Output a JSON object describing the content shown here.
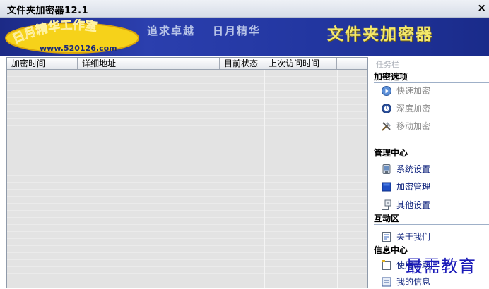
{
  "window": {
    "title": "文件夹加密器12.1",
    "close_glyph": "×"
  },
  "banner": {
    "logo_text": "日月精华工作室",
    "logo_url_text": "www.520126.com",
    "slogan_1": "追求卓越",
    "slogan_2": "日月精华",
    "app_name": "文件夹加密器"
  },
  "list": {
    "columns": [
      "加密时间",
      "详细地址",
      "目前状态",
      "上次访问时间"
    ]
  },
  "task_pane": {
    "title": "任务栏",
    "groups": [
      {
        "label": "加密选项",
        "items": [
          {
            "label": "快速加密",
            "icon": "quick-encrypt-icon"
          },
          {
            "label": "深度加密",
            "icon": "deep-encrypt-icon"
          },
          {
            "label": "移动加密",
            "icon": "move-encrypt-icon"
          }
        ]
      },
      {
        "label": "管理中心",
        "items": [
          {
            "label": "系统设置",
            "icon": "system-settings-icon"
          },
          {
            "label": "加密管理",
            "icon": "encrypt-manage-icon"
          },
          {
            "label": "其他设置",
            "icon": "other-settings-icon"
          }
        ]
      },
      {
        "label": "互动区",
        "items": [
          {
            "label": "关于我们",
            "icon": "about-icon"
          }
        ]
      },
      {
        "label": "信息中心",
        "items": [
          {
            "label": "使用帮助",
            "icon": "help-icon"
          },
          {
            "label": "我的信息",
            "icon": "my-info-icon"
          }
        ]
      }
    ]
  },
  "watermark": "最需教育",
  "colors": {
    "banner": "#2236a0",
    "accent_gold": "#f4e86a",
    "link": "#0a1f7a"
  }
}
